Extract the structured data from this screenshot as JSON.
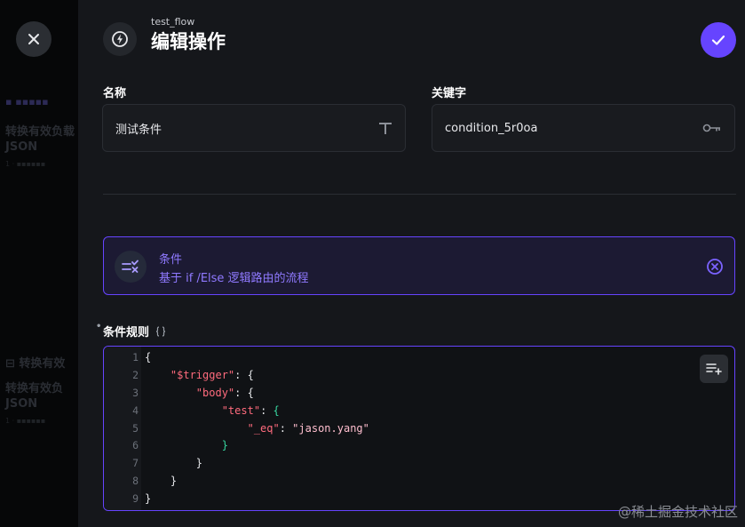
{
  "header": {
    "flow_name": "test_flow",
    "title": "编辑操作",
    "header_icon": "bolt-icon",
    "close_icon": "close-icon",
    "save_icon": "check-icon"
  },
  "fields": {
    "name_label": "名称",
    "name_value": "测试条件",
    "name_icon": "text-type-icon",
    "key_label": "关键字",
    "key_value": "condition_5r0oa",
    "key_icon": "key-icon"
  },
  "operation": {
    "title": "条件",
    "description": "基于 if /Else 逻辑路由的流程",
    "icon": "condition-icon",
    "remove_icon": "remove-icon"
  },
  "rules": {
    "label": "条件规则",
    "label_icon": "braces-icon",
    "insert_icon": "insert-list-icon",
    "line_numbers": [
      "1",
      "2",
      "3",
      "4",
      "5",
      "6",
      "7",
      "8",
      "9"
    ]
  },
  "background": {
    "fragments": [
      "转换有效负载",
      "JSON",
      "转换有效负",
      "JSON"
    ]
  },
  "watermark": "@稀土掘金技术社区",
  "colors": {
    "accent": "#6644ff",
    "panel": "#15171b",
    "code_key": "#ff6b7d",
    "code_string": "#ffbfcf",
    "code_bracket": "#38d6a0"
  }
}
